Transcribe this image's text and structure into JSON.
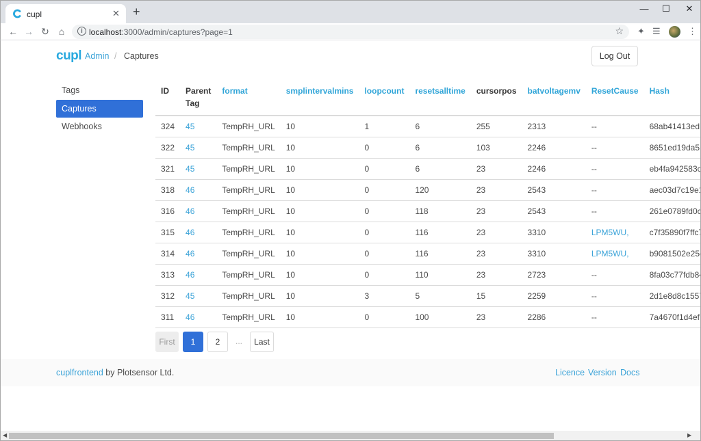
{
  "browser": {
    "tab_title": "cupl",
    "tab_close": "✕",
    "new_tab": "+",
    "url_host": "localhost",
    "url_rest": ":3000/admin/captures?page=1",
    "win_minimize": "—",
    "win_maximize": "☐",
    "win_close": "✕"
  },
  "header": {
    "brand": "cupl",
    "crumb_admin": "Admin",
    "crumb_sep": "/",
    "crumb_current": "Captures",
    "logout_label": "Log Out"
  },
  "menu": {
    "items": [
      {
        "label": "Tags"
      },
      {
        "label": "Captures"
      },
      {
        "label": "Webhooks"
      }
    ]
  },
  "table": {
    "columns": [
      "ID",
      "Parent\nTag",
      "format",
      "smplintervalmins",
      "loopcount",
      "resetsalltime",
      "cursorpos",
      "batvoltagemv",
      "ResetCause",
      "Hash"
    ],
    "rows": [
      [
        "324",
        "45",
        "TempRH_URL",
        "10",
        "1",
        "6",
        "255",
        "2313",
        "--",
        "68ab41413ed"
      ],
      [
        "322",
        "45",
        "TempRH_URL",
        "10",
        "0",
        "6",
        "103",
        "2246",
        "--",
        "8651ed19da5"
      ],
      [
        "321",
        "45",
        "TempRH_URL",
        "10",
        "0",
        "6",
        "23",
        "2246",
        "--",
        "eb4fa942583c"
      ],
      [
        "318",
        "46",
        "TempRH_URL",
        "10",
        "0",
        "120",
        "23",
        "2543",
        "--",
        "aec03d7c19e1"
      ],
      [
        "316",
        "46",
        "TempRH_URL",
        "10",
        "0",
        "118",
        "23",
        "2543",
        "--",
        "261e0789fd0c"
      ],
      [
        "315",
        "46",
        "TempRH_URL",
        "10",
        "0",
        "116",
        "23",
        "3310",
        "LPM5WU,",
        "c7f35890f7ffc7"
      ],
      [
        "314",
        "46",
        "TempRH_URL",
        "10",
        "0",
        "116",
        "23",
        "3310",
        "LPM5WU,",
        "b9081502e25e"
      ],
      [
        "313",
        "46",
        "TempRH_URL",
        "10",
        "0",
        "110",
        "23",
        "2723",
        "--",
        "8fa03c77fdb84"
      ],
      [
        "312",
        "45",
        "TempRH_URL",
        "10",
        "3",
        "5",
        "15",
        "2259",
        "--",
        "2d1e8d8c1557"
      ],
      [
        "311",
        "46",
        "TempRH_URL",
        "10",
        "0",
        "100",
        "23",
        "2286",
        "--",
        "7a4670f1d4ef"
      ]
    ]
  },
  "pagination": {
    "first": "First",
    "page1": "1",
    "page2": "2",
    "ellipsis": "...",
    "last": "Last"
  },
  "footer": {
    "app_link": "cuplfrontend",
    "by_text": " by Plotsensor Ltd.",
    "licence": "Licence",
    "version": "Version",
    "docs": "Docs"
  },
  "colors": {
    "accent": "#3070d8",
    "link": "#3ba3d8",
    "brand": "#29a9df"
  }
}
